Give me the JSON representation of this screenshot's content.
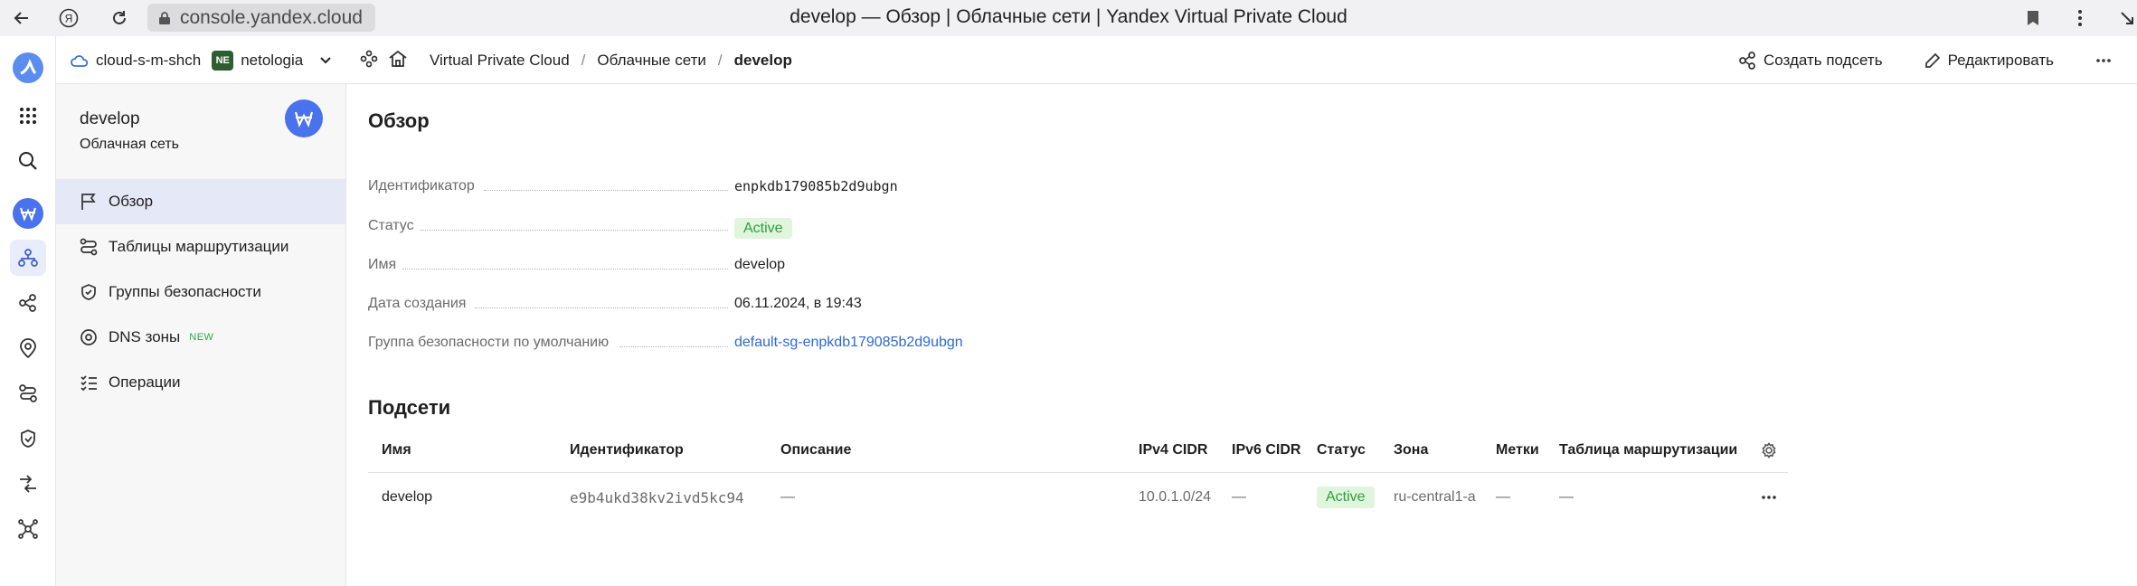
{
  "browser": {
    "url": "console.yandex.cloud",
    "tab_title": "develop — Обзор | Облачные сети | Yandex Virtual Private Cloud"
  },
  "topbar": {
    "cloud_name": "cloud-s-m-shch",
    "org_badge": "NE",
    "org_name": "netologia",
    "breadcrumbs": [
      "Virtual Private Cloud",
      "Облачные сети",
      "develop"
    ],
    "separator": "/",
    "actions": {
      "create_subnet": "Создать подсеть",
      "edit": "Редактировать"
    }
  },
  "sidepanel": {
    "title": "develop",
    "subtitle": "Облачная сеть",
    "items": [
      {
        "label": "Обзор",
        "active": true
      },
      {
        "label": "Таблицы маршрутизации"
      },
      {
        "label": "Группы безопасности"
      },
      {
        "label": "DNS зоны",
        "badge": "NEW"
      },
      {
        "label": "Операции"
      }
    ]
  },
  "overview": {
    "heading": "Обзор",
    "fields": {
      "id_label": "Идентификатор",
      "id_value": "enpkdb179085b2d9ubgn",
      "status_label": "Статус",
      "status_value": "Active",
      "name_label": "Имя",
      "name_value": "develop",
      "created_label": "Дата создания",
      "created_value": "06.11.2024, в 19:43",
      "sg_label": "Группа безопасности по умолчанию",
      "sg_value": "default-sg-enpkdb179085b2d9ubgn"
    }
  },
  "subnets": {
    "heading": "Подсети",
    "columns": [
      "Имя",
      "Идентификатор",
      "Описание",
      "IPv4 CIDR",
      "IPv6 CIDR",
      "Статус",
      "Зона",
      "Метки",
      "Таблица маршрутизации"
    ],
    "rows": [
      {
        "name": "develop",
        "id": "e9b4ukd38kv2ivd5kc94",
        "description": "—",
        "ipv4": "10.0.1.0/24",
        "ipv6": "—",
        "status": "Active",
        "zone": "ru-central1-a",
        "labels": "—",
        "route_table": "—"
      }
    ]
  },
  "colors": {
    "accent": "#4a72ec",
    "active_bg": "#dff5dc",
    "active_text": "#2e9e3e",
    "link": "#2f67d8",
    "org_badge": "#2f5d32"
  }
}
